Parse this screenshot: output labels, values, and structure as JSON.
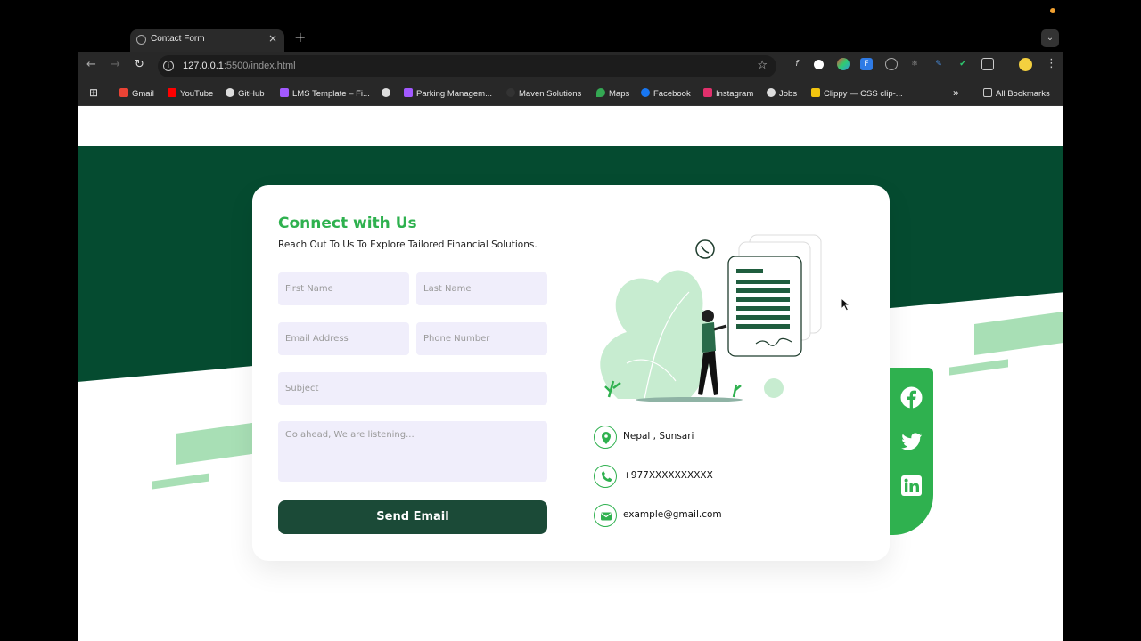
{
  "browser": {
    "tab_title": "Contact Form",
    "new_tab": "+",
    "tab_close": "×",
    "url_host": "127.0.0.1",
    "url_path": ":5500/index.html",
    "bookmarks": [
      {
        "label": "Gmail",
        "icon": "gmail-icon"
      },
      {
        "label": "YouTube",
        "icon": "youtube-icon"
      },
      {
        "label": "GitHub",
        "icon": "github-icon"
      },
      {
        "label": "LMS Template – Fi...",
        "icon": "figma-icon"
      },
      {
        "label": "",
        "icon": "globe-icon"
      },
      {
        "label": "Parking Managem...",
        "icon": "figma-icon"
      },
      {
        "label": "Maven Solutions",
        "icon": "maven-icon"
      },
      {
        "label": "Maps",
        "icon": "maps-icon"
      },
      {
        "label": "Facebook",
        "icon": "facebook-icon"
      },
      {
        "label": "Instagram",
        "icon": "instagram-icon"
      },
      {
        "label": "Jobs",
        "icon": "globe-icon"
      },
      {
        "label": "Clippy — CSS clip-...",
        "icon": "clippy-icon"
      }
    ],
    "bookmarks_overflow": "»",
    "all_bookmarks": "All Bookmarks"
  },
  "contact": {
    "heading": "Connect with Us",
    "subheading": "Reach Out To Us To Explore Tailored Financial Solutions.",
    "first_name_placeholder": "First Name",
    "last_name_placeholder": "Last Name",
    "email_placeholder": "Email Address",
    "phone_placeholder": "Phone Number",
    "subject_placeholder": "Subject",
    "message_placeholder": "Go ahead, We are listening...",
    "send_label": "Send Email",
    "location": "Nepal , Sunsari",
    "phone": "+977XXXXXXXXXX",
    "email": "example@gmail.com"
  },
  "colors": {
    "brand_green": "#2fb14f",
    "dark_green": "#054b30",
    "button_green": "#1b4a37",
    "input_bg": "#f0eefb"
  },
  "social": [
    "facebook-icon",
    "twitter-icon",
    "linkedin-icon"
  ]
}
